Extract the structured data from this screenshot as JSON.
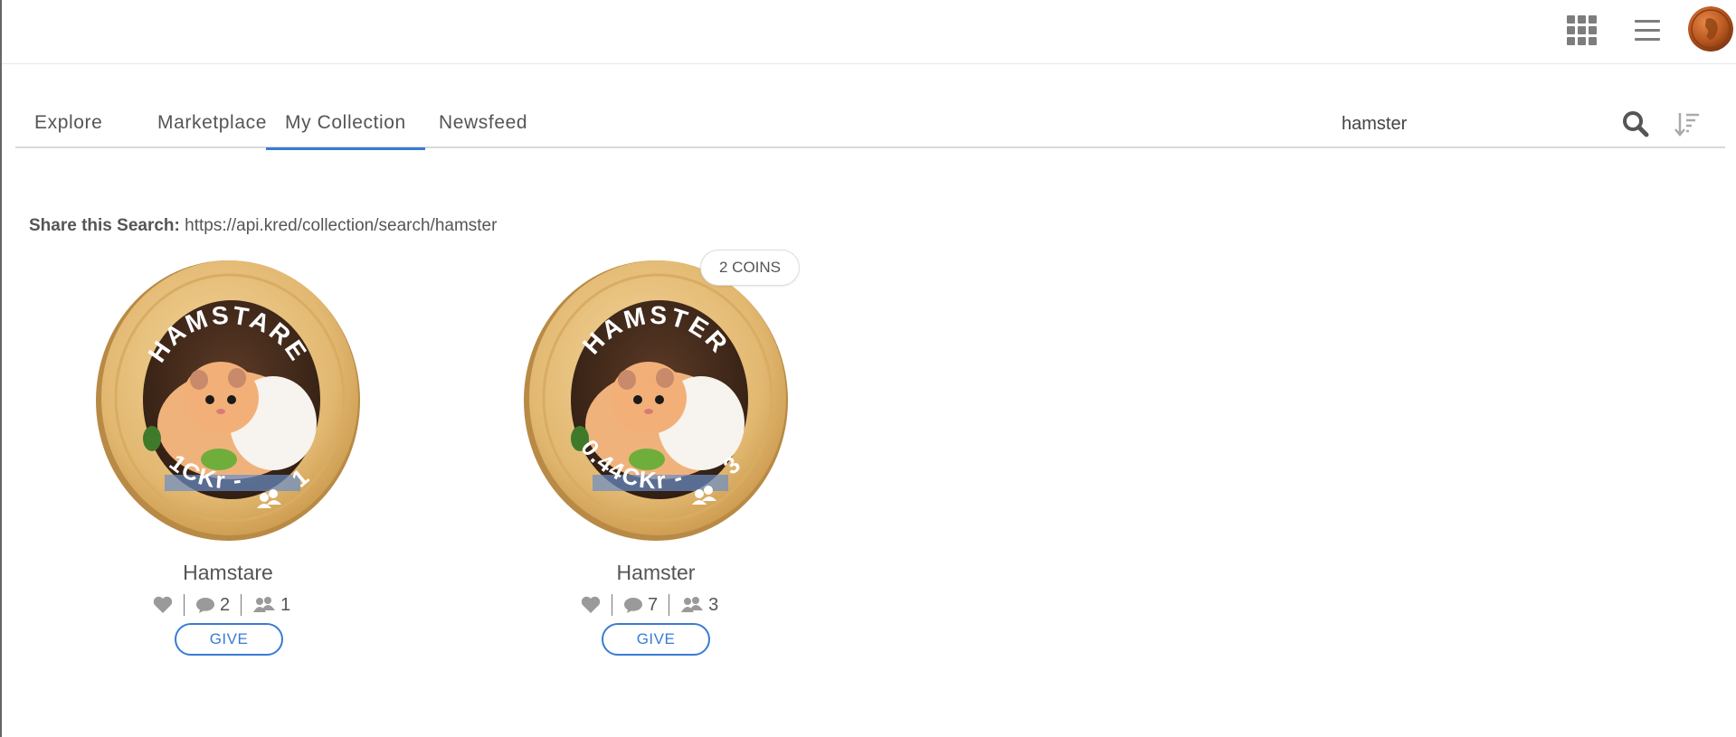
{
  "header": {
    "apps_icon": "apps-grid-icon",
    "menu_icon": "hamburger-menu-icon",
    "avatar_icon": "penny-avatar"
  },
  "nav": {
    "tabs": [
      {
        "label": "Explore",
        "active": false
      },
      {
        "label": "Marketplace",
        "active": false
      },
      {
        "label": "My Collection",
        "active": true
      },
      {
        "label": "Newsfeed",
        "active": false
      }
    ],
    "search_value": "hamster",
    "search_icon": "search-icon",
    "sort_icon": "sort-descending-icon",
    "accent_color": "#3a7bd5"
  },
  "share": {
    "label": "Share this Search:",
    "url": "https://api.kred/collection/search/hamster"
  },
  "coins": [
    {
      "name": "Hamstare",
      "rim_top": "HAMSTARE",
      "rim_bottom_value": "1CKr -",
      "rim_bottom_count": "1",
      "likes_icon": "heart-icon",
      "comments": "2",
      "holders": "1",
      "give_label": "GIVE",
      "badge": ""
    },
    {
      "name": "Hamster",
      "rim_top": "HAMSTER",
      "rim_bottom_value": "0.44CKr -",
      "rim_bottom_count": "3",
      "likes_icon": "heart-icon",
      "comments": "7",
      "holders": "3",
      "give_label": "GIVE",
      "badge": "2 COINS"
    }
  ],
  "colors": {
    "coin_gold": "#e2b871",
    "coin_gold_dark": "#c9974a",
    "link_blue": "#3a7bd5"
  }
}
